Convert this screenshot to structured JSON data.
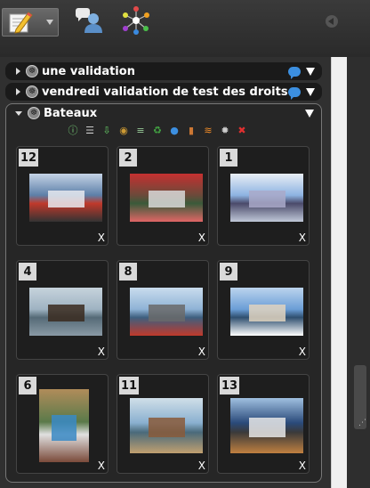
{
  "toolbar": {
    "buttons": [
      {
        "icon": "edit-note-icon"
      },
      {
        "icon": "users-chat-icon"
      },
      {
        "icon": "network-icon"
      }
    ]
  },
  "sections": [
    {
      "title": "une validation",
      "collapsed": true
    },
    {
      "title": "vendredi validation de test des droits",
      "collapsed": true
    }
  ],
  "bateaux": {
    "title": "Bateaux",
    "tools": [
      {
        "icon": "info-icon",
        "color": "#7bd67b",
        "glyph": "ⓘ"
      },
      {
        "icon": "list-icon",
        "color": "#cccccc",
        "glyph": "☰"
      },
      {
        "icon": "download-icon",
        "color": "#66cc66",
        "glyph": "⇩"
      },
      {
        "icon": "traffic-light-icon",
        "color": "#cc9933",
        "glyph": "◉"
      },
      {
        "icon": "stack-icon",
        "color": "#99cc99",
        "glyph": "≡"
      },
      {
        "icon": "recycle-icon",
        "color": "#44aa44",
        "glyph": "♻"
      },
      {
        "icon": "comment-icon",
        "color": "#3c8fe0",
        "glyph": "●"
      },
      {
        "icon": "door-icon",
        "color": "#cc7733",
        "glyph": "▮"
      },
      {
        "icon": "rss-icon",
        "color": "#f28c28",
        "glyph": "≋"
      },
      {
        "icon": "settings-icon",
        "color": "#cccccc",
        "glyph": "✹"
      },
      {
        "icon": "delete-icon",
        "color": "#e03030",
        "glyph": "✖"
      }
    ],
    "remove_label": "X",
    "items": [
      {
        "num": "12",
        "palette": [
          "#5d7fa8",
          "#c5d3e6",
          "#e8eaf0",
          "#c0392b",
          "#333333"
        ]
      },
      {
        "num": "2",
        "palette": [
          "#6b4a3a",
          "#c53030",
          "#d9d9d9",
          "#3a5a3a",
          "#e06666"
        ]
      },
      {
        "num": "1",
        "palette": [
          "#8db3e2",
          "#e9eef5",
          "#a9a9c9",
          "#4a4a6a",
          "#c0c8d8"
        ]
      },
      {
        "num": "4",
        "palette": [
          "#9fb3c2",
          "#c6d3dc",
          "#3a2a1e",
          "#556a77",
          "#8a9aa5"
        ]
      },
      {
        "num": "8",
        "palette": [
          "#8fb3d6",
          "#c9dced",
          "#6a6a6a",
          "#3e5f7f",
          "#c0392b"
        ]
      },
      {
        "num": "9",
        "palette": [
          "#6b9ed6",
          "#bcd4ee",
          "#e0d4c0",
          "#2f4f6f",
          "#ffffff"
        ]
      },
      {
        "num": "6",
        "palette": [
          "#5a7a4a",
          "#b08c5a",
          "#3a8ac6",
          "#e0e0e0",
          "#7a4a3a"
        ]
      },
      {
        "num": "11",
        "palette": [
          "#8ab0d0",
          "#d0dfe8",
          "#8a5a3a",
          "#4a6a7a",
          "#c0a070"
        ]
      },
      {
        "num": "13",
        "palette": [
          "#2a4a7a",
          "#a0c0e0",
          "#e8e8e8",
          "#3a3a3a",
          "#c08040"
        ]
      }
    ]
  }
}
